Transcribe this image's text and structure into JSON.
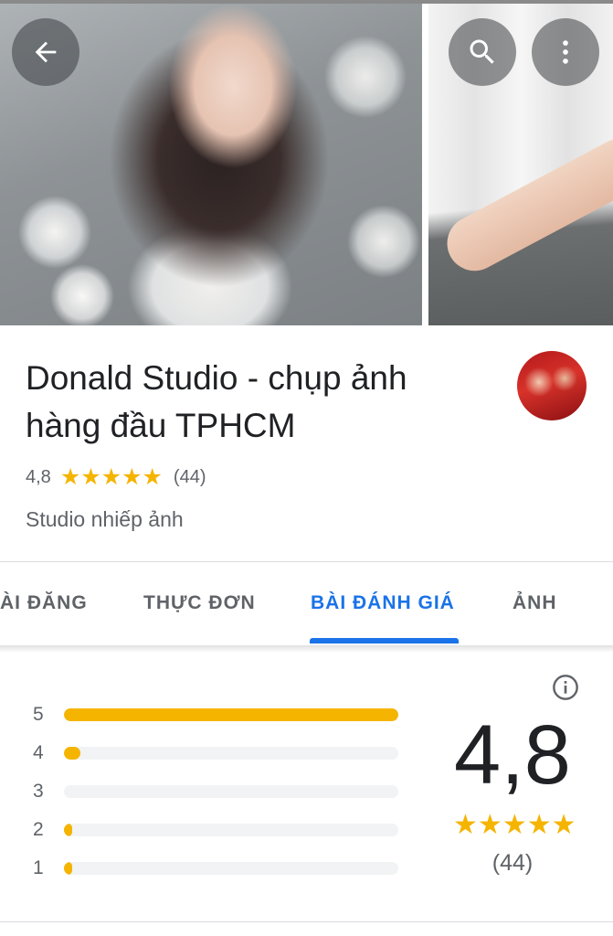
{
  "header": {
    "back_icon": "arrow-back-icon",
    "search_icon": "search-icon",
    "more_icon": "more-vert-icon"
  },
  "place": {
    "name": "Donald Studio - chụp ảnh hàng đầu TPHCM",
    "rating": "4,8",
    "stars": 5,
    "review_count": "(44)",
    "category": "Studio nhiếp ảnh"
  },
  "tabs": [
    {
      "label": "ÀI ĐĂNG",
      "active": false
    },
    {
      "label": "THỰC ĐƠN",
      "active": false
    },
    {
      "label": "BÀI ĐÁNH GIÁ",
      "active": true
    },
    {
      "label": "ẢNH",
      "active": false
    }
  ],
  "reviews": {
    "histogram": [
      {
        "label": "5",
        "fraction": 1.0
      },
      {
        "label": "4",
        "fraction": 0.05
      },
      {
        "label": "3",
        "fraction": 0.0
      },
      {
        "label": "2",
        "fraction": 0.025
      },
      {
        "label": "1",
        "fraction": 0.025
      }
    ],
    "score": "4,8",
    "count": "(44)",
    "info_icon": "info-icon"
  },
  "colors": {
    "accent": "#1a73e8",
    "star": "#f5b400"
  }
}
